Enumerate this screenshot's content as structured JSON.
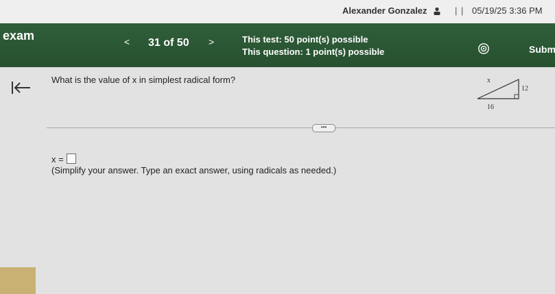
{
  "user": {
    "name": "Alexander Gonzalez",
    "timestamp": "05/19/25 3:36 PM"
  },
  "header": {
    "exam_title": "exam",
    "prev_label": "<",
    "counter": "31 of 50",
    "next_label": ">",
    "test_points": "This test: 50 point(s) possible",
    "question_points": "This question: 1 point(s) possible",
    "submit_label": "Subm"
  },
  "question": {
    "prompt": "What is the value of x in simplest radical form?",
    "figure": {
      "label_hyp": "x",
      "label_vertical": "12",
      "label_base": "16"
    },
    "more_label": "•••",
    "answer_label": "x =",
    "instructions": "(Simplify your answer. Type an exact answer, using radicals as needed.)"
  },
  "colors": {
    "header_bg": "#2f5e3a",
    "content_bg": "#e2e2e2"
  },
  "icons": [
    "user-icon",
    "settings-icon",
    "back-arrow-icon"
  ]
}
